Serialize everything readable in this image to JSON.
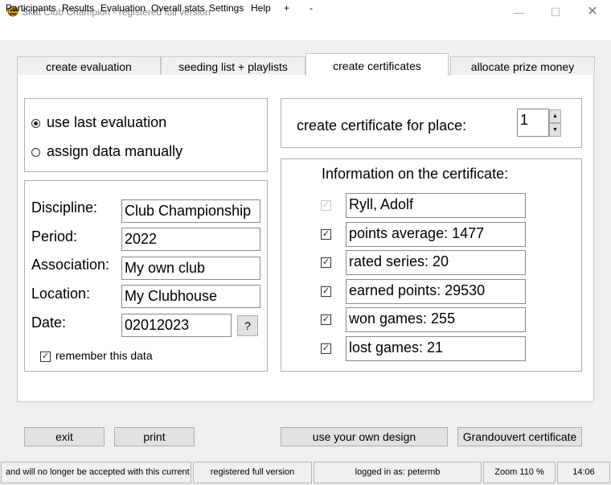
{
  "window": {
    "title": "Skat Club Champion - registered full version",
    "icon": "app-icon",
    "minimize": "—",
    "maximize": "☐",
    "close": "✕"
  },
  "menu": [
    "Participants",
    "Results",
    "Evaluation",
    "Overall stats",
    "Settings",
    "Help",
    "+",
    "-"
  ],
  "tabs": [
    "create evaluation",
    "seeding list + playlists",
    "create certificates",
    "allocate prize money"
  ],
  "active_tab": "create certificates",
  "source_options": {
    "use_last": "use last evaluation",
    "manual": "assign data manually",
    "selected": "use last evaluation"
  },
  "form": {
    "discipline_label": "Discipline:",
    "discipline": "Club Championship",
    "period_label": "Period:",
    "period": "2022",
    "association_label": "Association:",
    "association": "My own club",
    "location_label": "Location:",
    "location": "My Clubhouse",
    "date_label": "Date:",
    "date": "02012023",
    "date_help": "?",
    "remember_label": "remember this data",
    "remember_checked": true
  },
  "place": {
    "label": "create certificate for place:",
    "value": "1",
    "up": "▲",
    "down": "▼"
  },
  "info": {
    "heading": "Information on the certificate:",
    "rows": [
      {
        "text": "Ryll, Adolf",
        "checked": true,
        "disabled": true
      },
      {
        "text": "points average:  1477",
        "checked": true
      },
      {
        "text": "rated series:   20",
        "checked": true
      },
      {
        "text": "earned points: 29530",
        "checked": true
      },
      {
        "text": "won games:  255",
        "checked": true
      },
      {
        "text": "lost games:   21",
        "checked": true
      }
    ]
  },
  "buttons": {
    "exit": "exit",
    "print": "print",
    "own_design": "use your own design",
    "grandouvert": "Grandouvert certificate"
  },
  "status": {
    "message": "and will no longer be accepted with this current versio",
    "license": "registered full version",
    "user": "logged in as: petermb",
    "zoom": "Zoom 110 %",
    "time": "14:06"
  },
  "check_mark": "✓"
}
